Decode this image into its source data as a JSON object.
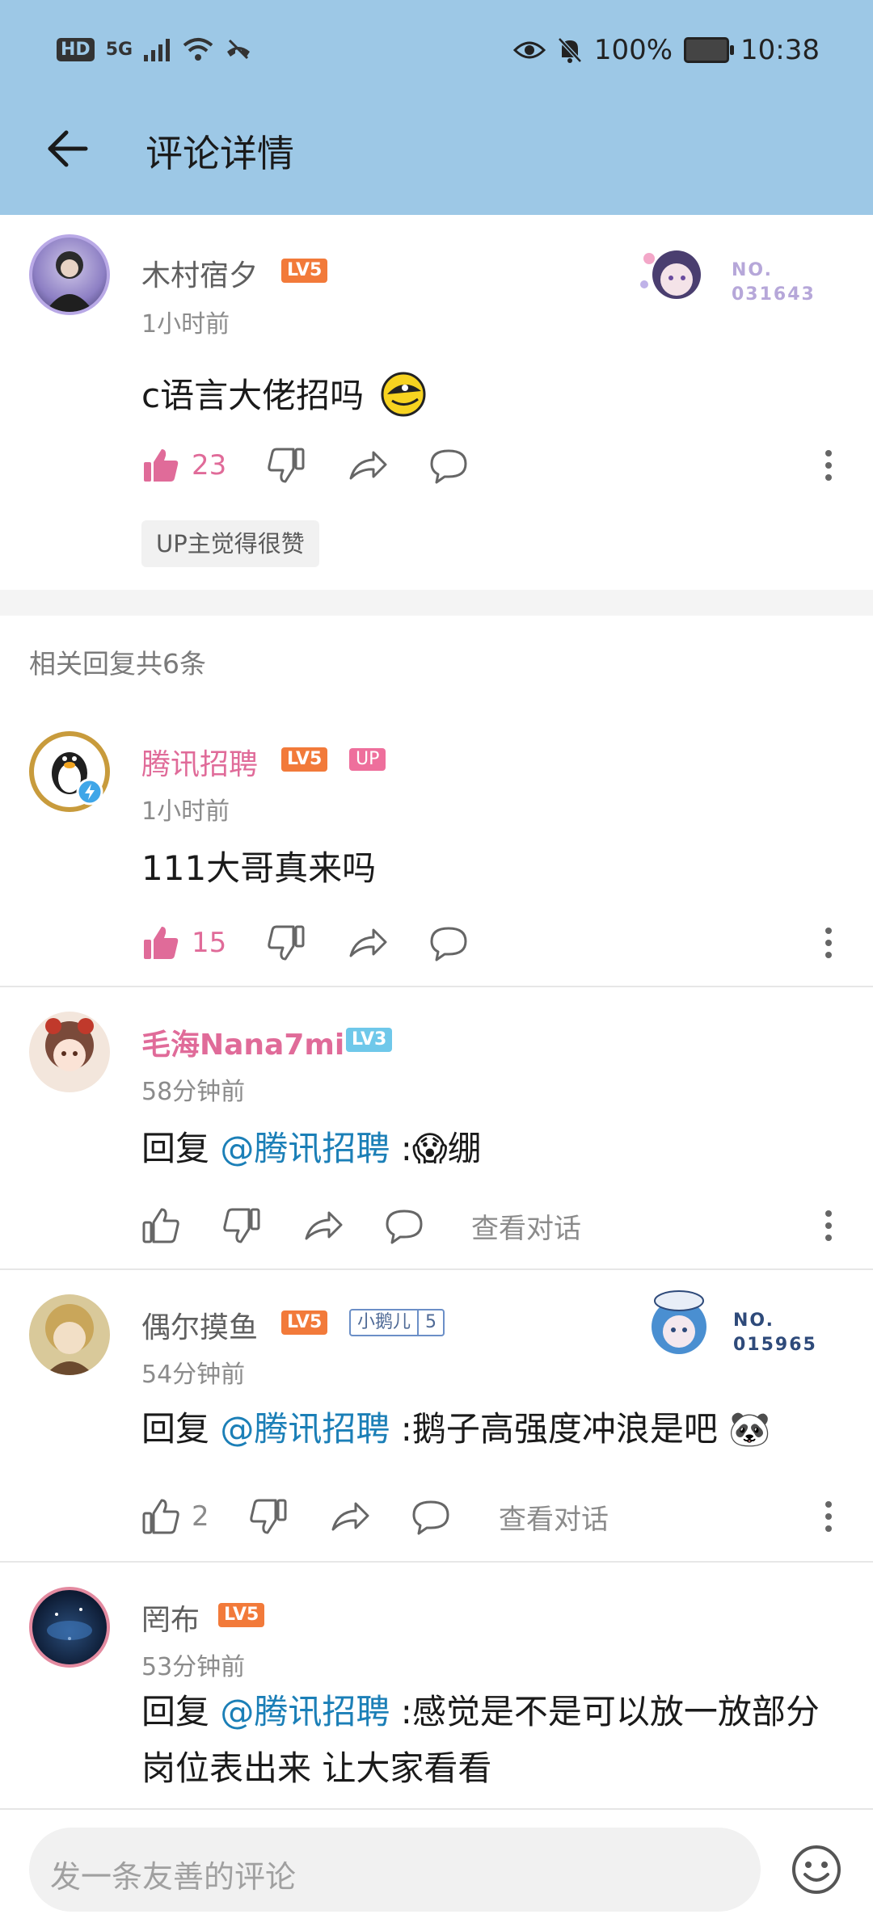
{
  "status_bar": {
    "hd": "HD",
    "network": "5G",
    "battery": "100%",
    "time": "10:38"
  },
  "header": {
    "title": "评论详情"
  },
  "main_comment": {
    "user": "木村宿夕",
    "level": "LV5",
    "time": "1小时前",
    "text": "c语言大佬招吗",
    "likes": "23",
    "decor_number": "NO.\n031643",
    "up_liked": "UP主觉得很赞"
  },
  "replies_header": "相关回复共6条",
  "replies": [
    {
      "user": "腾讯招聘",
      "level": "LV5",
      "badge": "UP",
      "time": "1小时前",
      "text": "111大哥真来吗",
      "likes": "15"
    },
    {
      "user": "毛海Nana7mi",
      "level": "LV3",
      "time": "58分钟前",
      "prefix": "回复 ",
      "mention": "@腾讯招聘",
      "text": " :😱绷",
      "view_conversation": "查看对话"
    },
    {
      "user": "偶尔摸鱼",
      "level": "LV5",
      "fan_badge_name": "小鹅儿",
      "fan_badge_level": "5",
      "time": "54分钟前",
      "prefix": "回复 ",
      "mention": "@腾讯招聘",
      "text": " :鹅子高强度冲浪是吧 🐼",
      "likes": "2",
      "decor_number": "NO.\n015965",
      "view_conversation": "查看对话"
    },
    {
      "user": "罔布",
      "level": "LV5",
      "time": "53分钟前",
      "prefix": "回复 ",
      "mention": "@腾讯招聘",
      "text": " :感觉是不是可以放一放部分岗位表出来 让大家看看"
    }
  ],
  "input": {
    "placeholder": "发一条友善的评论"
  },
  "colors": {
    "header_bg": "#9dc8e6",
    "accent_pink": "#e06b99",
    "mention_blue": "#1b7fb7",
    "level5": "#f27a3a",
    "level3": "#6fc8ea"
  }
}
